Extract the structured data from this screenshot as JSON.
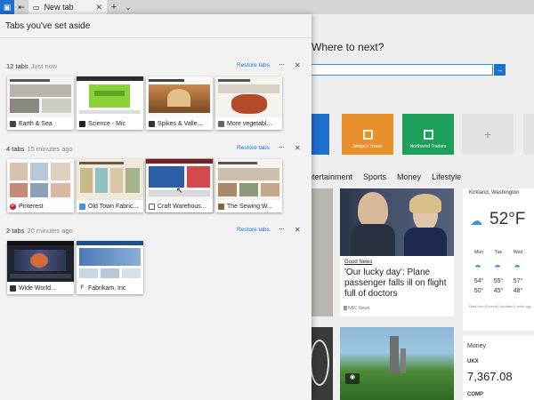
{
  "tabstrip": {
    "tab_title": "New tab",
    "close_glyph": "✕",
    "new_tab_glyph": "+",
    "dropdown_glyph": "⌄"
  },
  "ntp": {
    "heading": "Where to next?",
    "tiles": [
      "Melgo's Travel",
      "Northwind Traders"
    ],
    "tile_colors": [
      "#1e6fd0",
      "#e8912c",
      "#1ca05a"
    ],
    "categories": [
      "Entertainment",
      "Sports",
      "Money",
      "Lifestyle"
    ],
    "story1": {
      "badge": "Good News",
      "headline_lines": [
        "'Our lucky day': Plane",
        "passenger falls ill on flight",
        "full of doctors"
      ],
      "source": "NBC News"
    },
    "weather": {
      "location": "Kirkland, Washington",
      "temp": "52°F",
      "days": [
        "Mon",
        "Tue",
        "Wed"
      ],
      "highs": [
        "54°",
        "55°",
        "57°"
      ],
      "lows": [
        "50°",
        "45°",
        "48°"
      ],
      "footer": "Data from Foreca | Updated 4 mins ago"
    },
    "money": {
      "title": "Money",
      "sym1": "UKX",
      "val1": "7,367.08",
      "sym2": "COMP"
    }
  },
  "panel": {
    "title": "Tabs you've set aside",
    "restore_label": "Restore tabs",
    "more_glyph": "···",
    "close_glyph": "✕",
    "groups": [
      {
        "count": "12 tabs",
        "time": "Just now",
        "tabs": [
          {
            "label": "Earth & Sea",
            "fav": "#444"
          },
          {
            "label": "Science - Mic",
            "fav": "#222"
          },
          {
            "label": "Spikes & Valle...",
            "fav": "#333"
          },
          {
            "label": "More vegetabl...",
            "fav": "#666"
          }
        ]
      },
      {
        "count": "4 tabs",
        "time": "15 minutes ago",
        "tabs": [
          {
            "label": "Pinterest",
            "fav": "#c8232c"
          },
          {
            "label": "Old Town Fabric...",
            "fav": "#4a90d9"
          },
          {
            "label": "Craft Warehous...",
            "fav": "#555"
          },
          {
            "label": "The Sewing W...",
            "fav": "#7a6a3a"
          }
        ]
      },
      {
        "count": "2 tabs",
        "time": "20 minutes ago",
        "tabs": [
          {
            "label": "Wide World...",
            "fav": "#333"
          },
          {
            "label": "Fabrikam, Inc",
            "fav": "#1e6fd0"
          }
        ]
      }
    ]
  }
}
